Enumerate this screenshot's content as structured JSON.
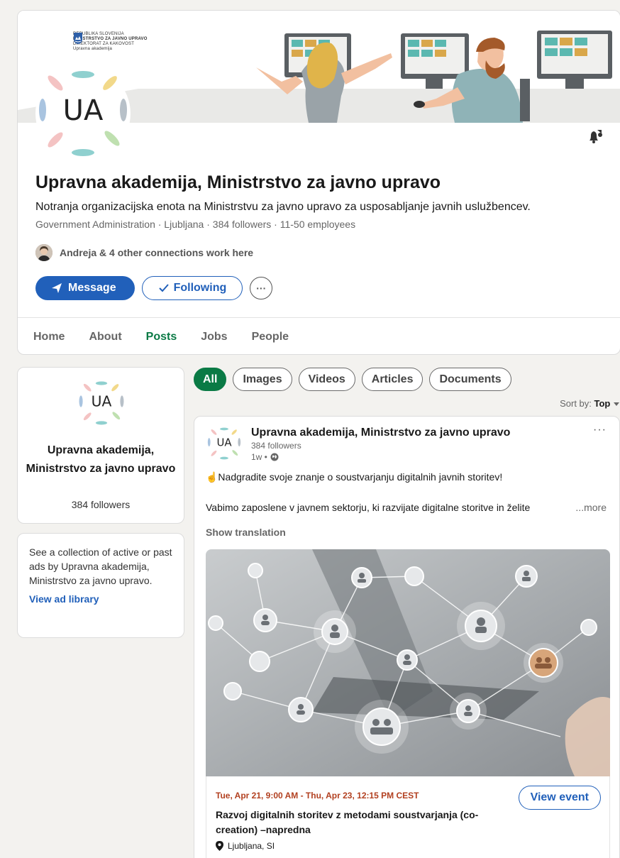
{
  "banner": {
    "gov_lines": [
      "REPUBLIKA SLOVENIJA",
      "MINISTRSTVO ZA JAVNO UPRAVO",
      "DIREKTORAT ZA KAKOVOST",
      "Upravna akademija"
    ]
  },
  "org": {
    "logo_text": "UA",
    "title": "Upravna akademija, Ministrstvo za javno upravo",
    "tagline": "Notranja organizacijska enota na Ministrstvu za javno upravo za usposabljanje javnih uslužbencev.",
    "meta": "Government Administration · Ljubljana · 384 followers · 11-50 employees",
    "connections": "Andreja & 4 other connections work here"
  },
  "actions": {
    "message_label": "Message",
    "following_label": "Following",
    "more_label": "···"
  },
  "tabs": [
    {
      "label": "Home"
    },
    {
      "label": "About"
    },
    {
      "label": "Posts",
      "active": true
    },
    {
      "label": "Jobs"
    },
    {
      "label": "People"
    }
  ],
  "sidebar": {
    "name": "Upravna akademija, Ministrstvo za javno upravo",
    "followers": "384 followers",
    "ad_text": "See a collection of active or past ads by Upravna akademija, Ministrstvo za javno upravo.",
    "ad_link": "View ad library"
  },
  "filters": [
    {
      "label": "All",
      "active": true
    },
    {
      "label": "Images"
    },
    {
      "label": "Videos"
    },
    {
      "label": "Articles"
    },
    {
      "label": "Documents"
    }
  ],
  "sort": {
    "prefix": "Sort by:",
    "value": "Top"
  },
  "post": {
    "author": "Upravna akademija, Ministrstvo za javno upravo",
    "followers": "384 followers",
    "time": "1w •",
    "line1": "☝️Nadgradite svoje znanje o soustvarjanju digitalnih javnih storitev!",
    "line2": "Vabimo zaposlene v javnem sektorju, ki razvijate digitalne storitve in želite",
    "more": "...more",
    "translate": "Show translation",
    "event": {
      "date": "Tue, Apr 21, 9:00 AM - Thu, Apr 23, 12:15 PM CEST",
      "title": "Razvoj digitalnih storitev z metodami soustvarjanja (co-creation) –napredna",
      "location": "Ljubljana, SI",
      "button": "View event"
    }
  },
  "colors": {
    "brand_blue": "#2160ba",
    "active_green": "#0a7a45",
    "event_date": "#b24020"
  }
}
